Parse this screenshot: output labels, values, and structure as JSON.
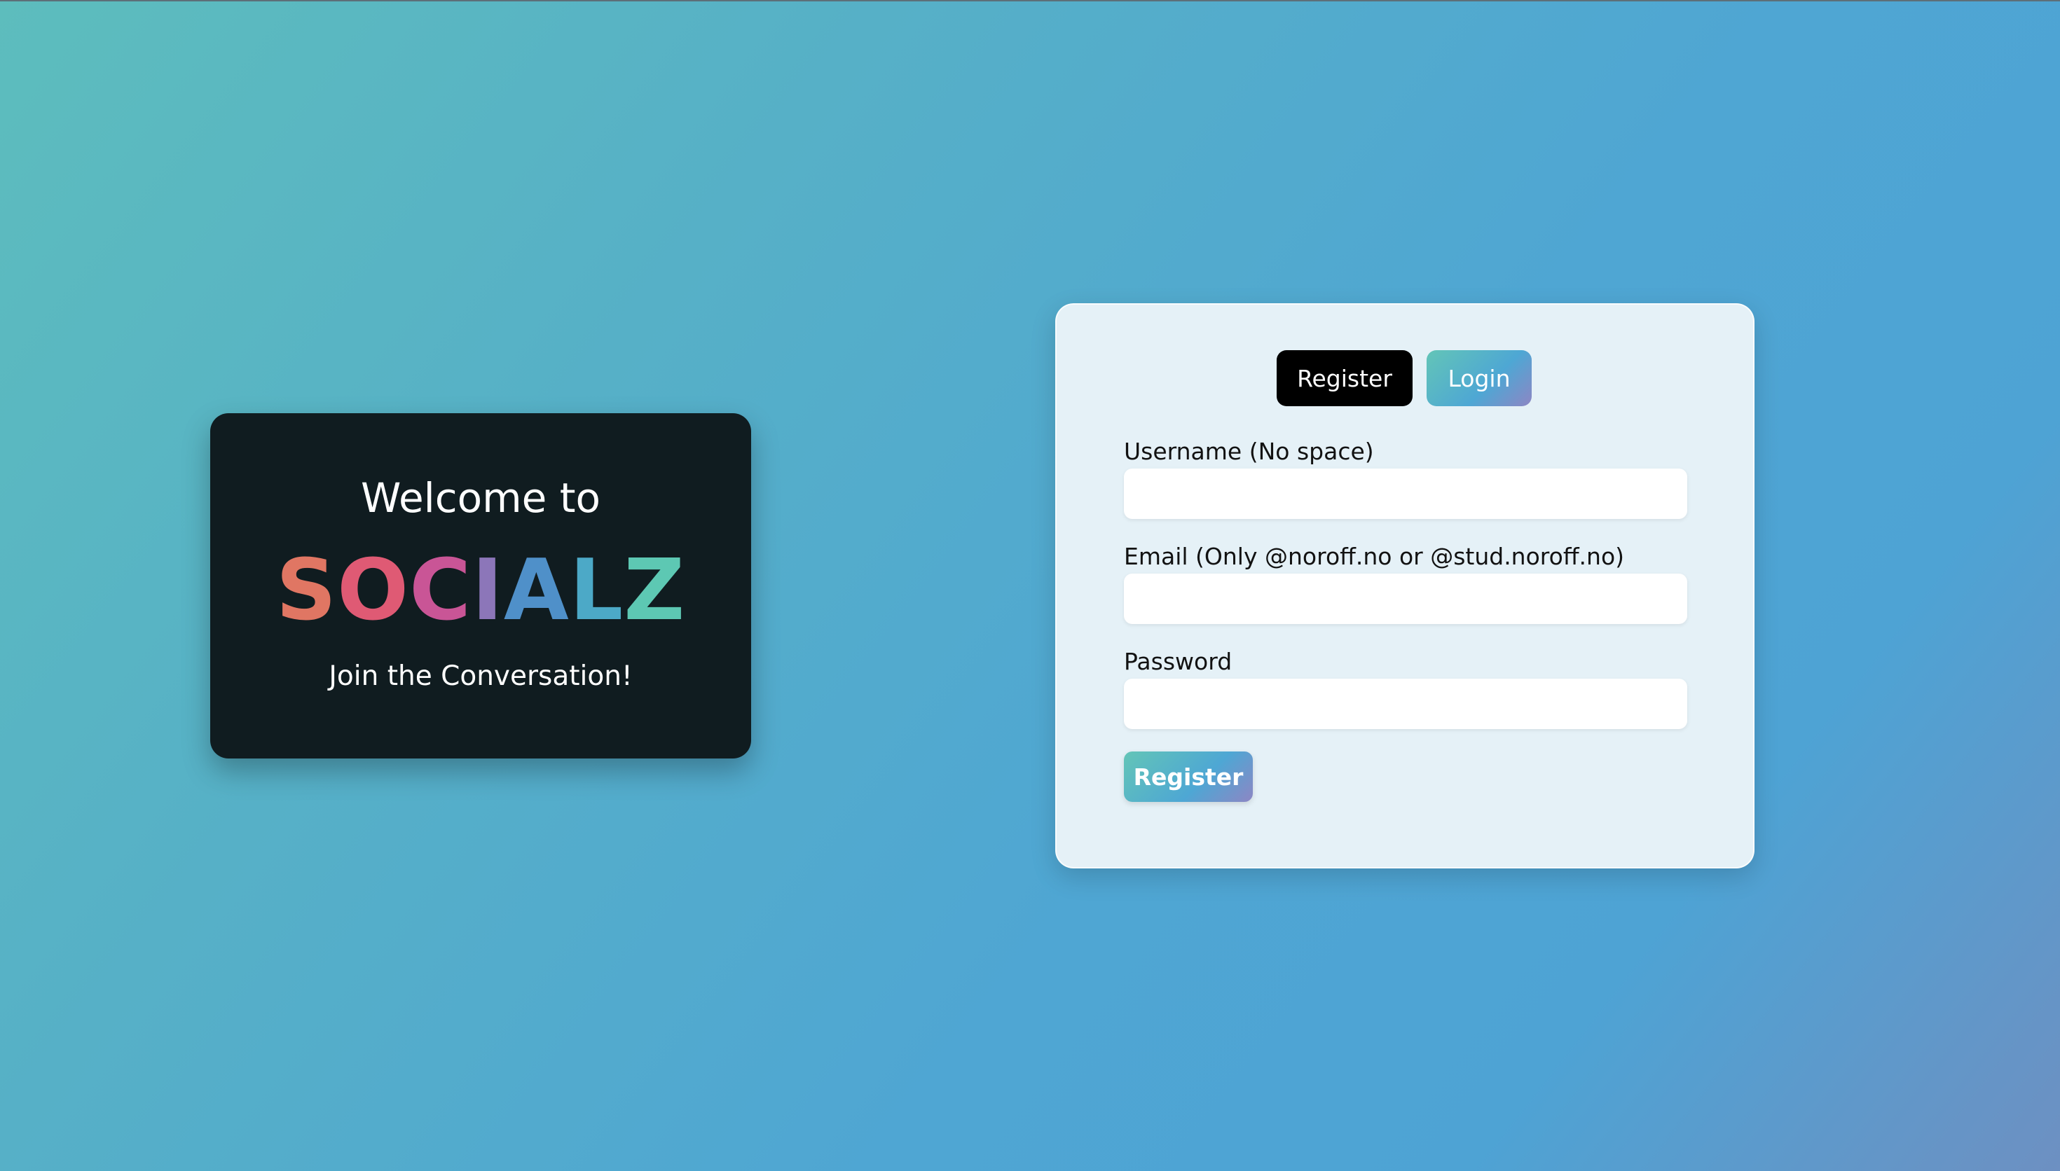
{
  "welcome": {
    "title": "Welcome to",
    "brand_letters": [
      {
        "char": "S",
        "color": "#e07663"
      },
      {
        "char": "O",
        "color": "#df5a74"
      },
      {
        "char": "C",
        "color": "#c95596"
      },
      {
        "char": "I",
        "color": "#8c76b9"
      },
      {
        "char": "A",
        "color": "#4f90c9"
      },
      {
        "char": "L",
        "color": "#4ca9c7"
      },
      {
        "char": "Z",
        "color": "#5dc8b3"
      }
    ],
    "tagline": "Join the Conversation!"
  },
  "form": {
    "tabs": {
      "register": "Register",
      "login": "Login"
    },
    "fields": {
      "username": {
        "label": "Username (No space)",
        "value": ""
      },
      "email": {
        "label": "Email (Only @noroff.no or @stud.noroff.no)",
        "value": ""
      },
      "password": {
        "label": "Password",
        "value": ""
      }
    },
    "submit_label": "Register"
  },
  "colors": {
    "background_start": "#5dbdbd",
    "background_end": "#6d90c2",
    "welcome_card": "#101c20",
    "form_card": "#e5f1f7",
    "active_tab": "#000000",
    "accent_gradient": [
      "#63c5b7",
      "#4ea7d4",
      "#8d86c4"
    ]
  }
}
